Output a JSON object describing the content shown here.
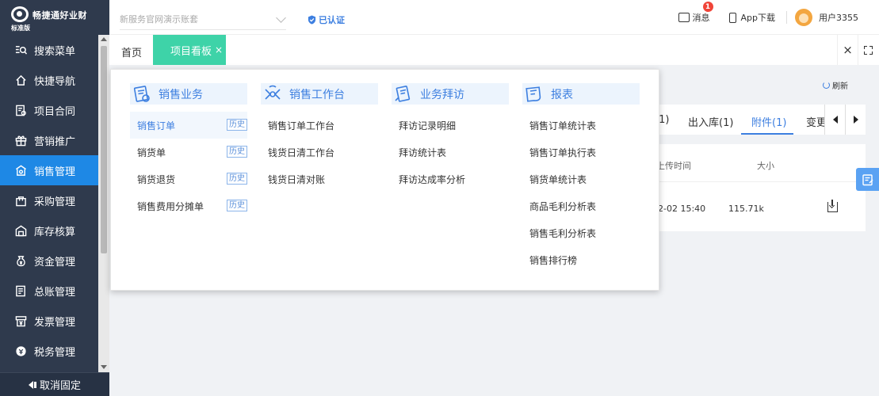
{
  "brand": {
    "name": "畅捷通好业财",
    "edition": "标准版"
  },
  "header": {
    "account_placeholder": "新服务官网演示账套",
    "verified": "已认证",
    "message_label": "消息",
    "message_badge": "1",
    "app_download": "App下载",
    "username": "用户3355"
  },
  "sidebar": {
    "items": [
      {
        "label": "搜索菜单",
        "icon": "search-menu-icon"
      },
      {
        "label": "快捷导航",
        "icon": "home-icon"
      },
      {
        "label": "项目合同",
        "icon": "contract-icon"
      },
      {
        "label": "营销推广",
        "icon": "gift-icon"
      },
      {
        "label": "销售管理",
        "icon": "sales-icon",
        "active": true
      },
      {
        "label": "采购管理",
        "icon": "bag-icon"
      },
      {
        "label": "库存核算",
        "icon": "warehouse-icon"
      },
      {
        "label": "资金管理",
        "icon": "money-bag-icon"
      },
      {
        "label": "总账管理",
        "icon": "ledger-icon"
      },
      {
        "label": "发票管理",
        "icon": "invoice-icon"
      },
      {
        "label": "税务管理",
        "icon": "tax-icon"
      }
    ],
    "unpin": "取消固定"
  },
  "tabs": {
    "home": "首页",
    "active": "项目看板",
    "close": "×",
    "close_all": "×"
  },
  "content": {
    "refresh": "刷新",
    "subtabs": [
      "(1)",
      "出入库(1)",
      "附件(1)",
      "变更"
    ],
    "table": {
      "headers": [
        "上传时间",
        "大小"
      ],
      "row": {
        "time": "2-02 15:40",
        "size": "115.71k"
      }
    }
  },
  "menu_panel": {
    "columns": [
      {
        "title": "销售业务",
        "icon": "sales-business-icon",
        "items": [
          {
            "label": "销售订单",
            "history": "历史",
            "selected": true
          },
          {
            "label": "销货单",
            "history": "历史"
          },
          {
            "label": "销货退货",
            "history": "历史"
          },
          {
            "label": "销售费用分摊单",
            "history": "历史"
          }
        ]
      },
      {
        "title": "销售工作台",
        "icon": "workbench-icon",
        "items": [
          {
            "label": "销售订单工作台"
          },
          {
            "label": "钱货日清工作台"
          },
          {
            "label": "钱货日清对账"
          }
        ]
      },
      {
        "title": "业务拜访",
        "icon": "visit-icon",
        "items": [
          {
            "label": "拜访记录明细"
          },
          {
            "label": "拜访统计表"
          },
          {
            "label": "拜访达成率分析"
          }
        ]
      },
      {
        "title": "报表",
        "icon": "report-icon",
        "items": [
          {
            "label": "销售订单统计表"
          },
          {
            "label": "销售订单执行表"
          },
          {
            "label": "销货单统计表"
          },
          {
            "label": "商品毛利分析表"
          },
          {
            "label": "销售毛利分析表"
          },
          {
            "label": "销售排行榜"
          }
        ]
      }
    ]
  },
  "colors": {
    "sidebar_bg": "#2f3a4d",
    "active_menu": "#1e88e5",
    "active_tab": "#3ed3a8",
    "accent": "#3d7fe0"
  }
}
